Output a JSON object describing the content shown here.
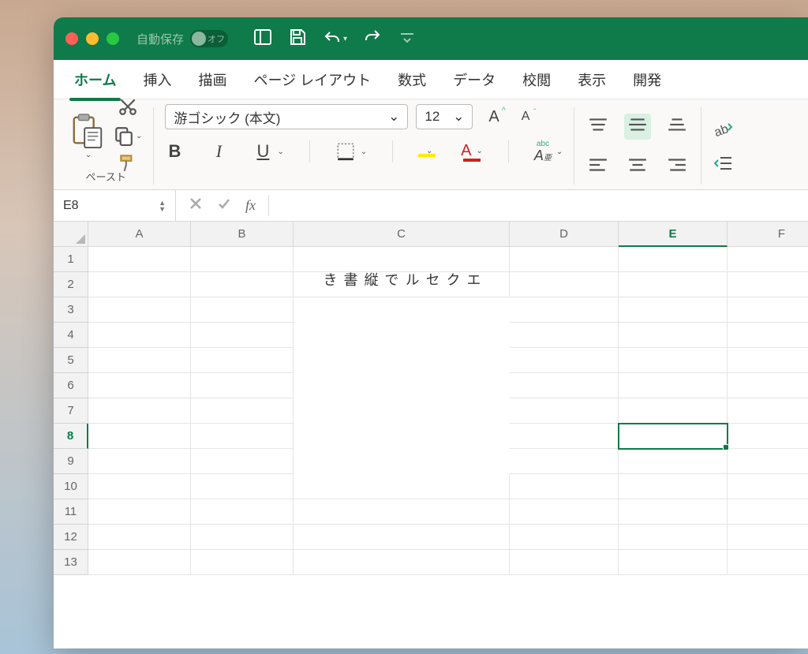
{
  "titlebar": {
    "autosave_label": "自動保存",
    "autosave_off_label": "オフ"
  },
  "tabs": [
    "ホーム",
    "挿入",
    "描画",
    "ページ レイアウト",
    "数式",
    "データ",
    "校閲",
    "表示",
    "開発"
  ],
  "active_tab_index": 0,
  "ribbon": {
    "paste_label": "ペースト",
    "font_name": "游ゴシック (本文)",
    "font_size": "12",
    "bold": "B",
    "italic": "I",
    "underline": "U",
    "phonetic_abc": "abc",
    "grow_font": "A",
    "shrink_font": "A",
    "font_color_letter": "A",
    "fill_color_hex": "#ffeb00",
    "font_color_hex": "#d21f1f"
  },
  "namebox": "E8",
  "columns": [
    "A",
    "B",
    "C",
    "D",
    "E",
    "F"
  ],
  "selected_col": "E",
  "rows": [
    1,
    2,
    3,
    4,
    5,
    6,
    7,
    8,
    9,
    10,
    11,
    12,
    13
  ],
  "selected_row": 8,
  "cell_c2_9_text": "エクセルで縦書き",
  "selected_cell": "E8"
}
